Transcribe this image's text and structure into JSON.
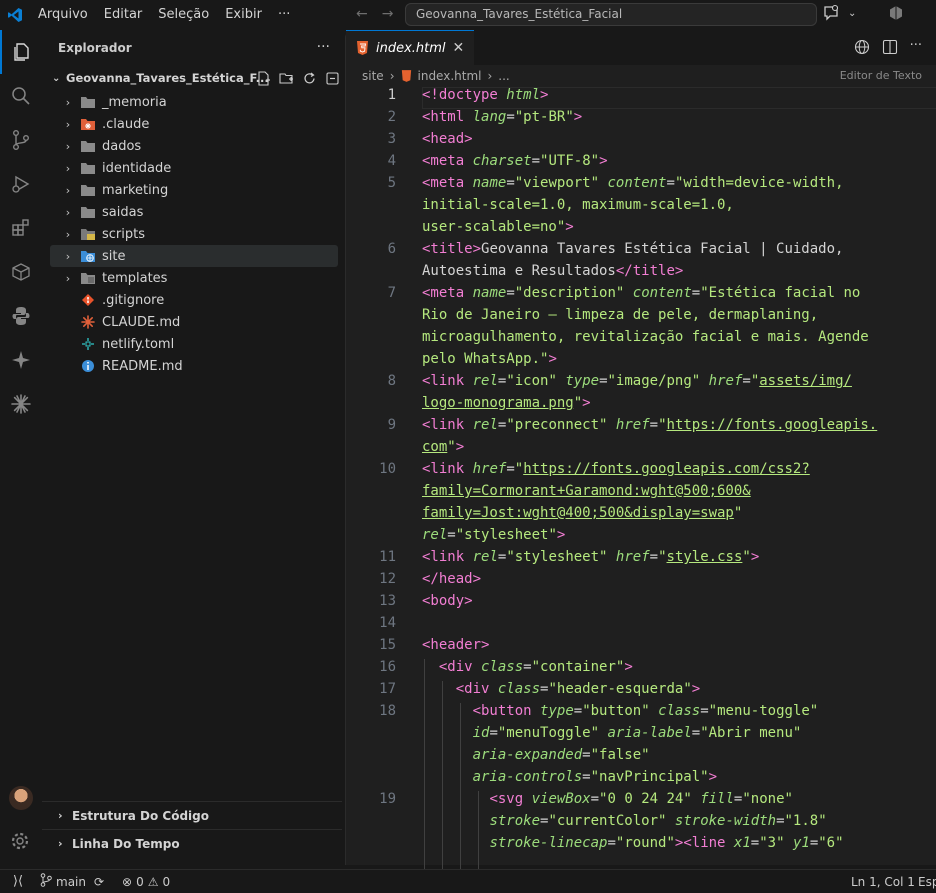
{
  "menu": [
    "Arquivo",
    "Editar",
    "Seleção",
    "Exibir",
    "···"
  ],
  "command_center": "Geovanna_Tavares_Estética_Facial",
  "explorer": {
    "title": "Explorador",
    "folder": "Geovanna_Tavares_Estética_F...",
    "items": [
      {
        "label": "_memoria",
        "type": "folder",
        "icon": "folder-icon"
      },
      {
        "label": ".claude",
        "type": "folder",
        "icon": "claude-folder-icon"
      },
      {
        "label": "dados",
        "type": "folder",
        "icon": "folder-icon"
      },
      {
        "label": "identidade",
        "type": "folder",
        "icon": "folder-icon"
      },
      {
        "label": "marketing",
        "type": "folder",
        "icon": "folder-icon"
      },
      {
        "label": "saidas",
        "type": "folder",
        "icon": "folder-icon"
      },
      {
        "label": "scripts",
        "type": "folder",
        "icon": "folder-scripts-icon"
      },
      {
        "label": "site",
        "type": "folder",
        "icon": "folder-globe-icon",
        "selected": true
      },
      {
        "label": "templates",
        "type": "folder",
        "icon": "folder-templates-icon"
      },
      {
        "label": ".gitignore",
        "type": "file",
        "icon": "git-icon"
      },
      {
        "label": "CLAUDE.md",
        "type": "file",
        "icon": "claude-icon"
      },
      {
        "label": "netlify.toml",
        "type": "file",
        "icon": "netlify-icon"
      },
      {
        "label": "README.md",
        "type": "file",
        "icon": "info-icon"
      }
    ],
    "outline": "Estrutura Do Código",
    "timeline": "Linha Do Tempo"
  },
  "editor": {
    "tab": "index.html",
    "breadcrumb": [
      "site",
      "index.html",
      "..."
    ],
    "mode": "Editor de Texto",
    "line_numbers": [
      "1",
      "2",
      "3",
      "4",
      "5",
      "6",
      "7",
      "8",
      "9",
      "10",
      "11",
      "12",
      "13",
      "14",
      "15",
      "16",
      "17",
      "18",
      "19"
    ]
  },
  "status": {
    "branch": "main",
    "errors": "0",
    "warnings": "0",
    "position": "Ln 1, Col 1",
    "spaces": "Esp"
  },
  "colors": {
    "tag": "#f27ed3",
    "attr": "#9cdc7c",
    "string": "#b5e87e",
    "accent": "#0078d4"
  }
}
